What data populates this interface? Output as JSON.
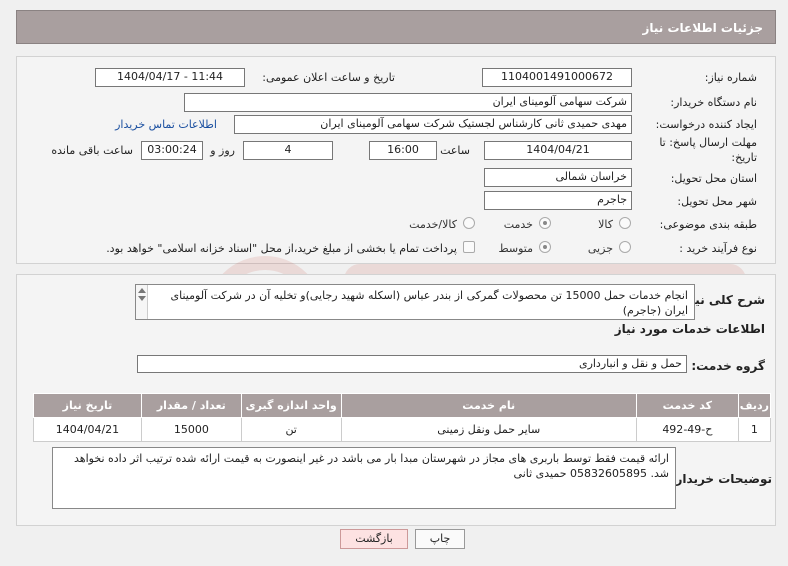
{
  "header": {
    "title": "جزئیات اطلاعات نیاز"
  },
  "form": {
    "need_number": {
      "label": "شماره نیاز:",
      "value": "1104001491000672"
    },
    "announce_datetime": {
      "label": "تاریخ و ساعت اعلان عمومی:",
      "value": "1404/04/17 - 11:44"
    },
    "buyer_org": {
      "label": "نام دستگاه خریدار:",
      "value": "شرکت سهامی آلومینای ایران"
    },
    "requester": {
      "label": "ایجاد کننده درخواست:",
      "value": "مهدی حمیدی ثانی کارشناس لجستیک شرکت سهامی آلومینای ایران",
      "contact_link": "اطلاعات تماس خریدار"
    },
    "deadline": {
      "label": "مهلت ارسال پاسخ: تا تاریخ:",
      "date": "1404/04/21",
      "time_label": "ساعت",
      "time": "16:00",
      "days": "4",
      "days_label": "روز و",
      "remaining": "03:00:24",
      "remaining_label": "ساعت باقی مانده"
    },
    "province": {
      "label": "استان محل تحویل:",
      "value": "خراسان شمالی"
    },
    "city": {
      "label": "شهر محل تحویل:",
      "value": "جاجرم"
    },
    "category": {
      "label": "طبقه بندی موضوعی:",
      "options": [
        "کالا",
        "خدمت",
        "کالا/خدمت"
      ],
      "selected": "خدمت"
    },
    "purchase_type": {
      "label": "نوع فرآیند خرید :",
      "options": [
        "جزیی",
        "متوسط"
      ],
      "selected": "متوسط",
      "payment_note": "پرداخت تمام یا بخشی از مبلغ خرید،از محل \"اسناد خزانه اسلامی\" خواهد بود."
    }
  },
  "summary": {
    "label": "شرح کلی نیاز:",
    "text": "انجام خدمات حمل 15000 تن محصولات گمرکی از بندر عباس (اسکله شهید رجایی)و تخلیه آن در شرکت آلومینای ایران (جاجرم)"
  },
  "services": {
    "section_title": "اطلاعات خدمات مورد نیاز",
    "group_label": "گروه خدمت:",
    "group_value": "حمل و نقل و انبارداری",
    "columns": [
      "ردیف",
      "کد خدمت",
      "نام خدمت",
      "واحد اندازه گیری",
      "تعداد / مقدار",
      "تاریخ نیاز"
    ],
    "rows": [
      {
        "row": "1",
        "code": "ح-49-492",
        "name": "سایر حمل ونقل زمینی",
        "unit": "تن",
        "qty": "15000",
        "date": "1404/04/21"
      }
    ]
  },
  "buyer_notes": {
    "label": "توضیحات خریدار:",
    "text": "ارائه قیمت فقط توسط باربری های مجاز در شهرستان مبدا بار می باشد در غیر اینصورت به قیمت ارائه شده ترتیب اثر داده نخواهد شد. 05832605895 حمیدی ثانی"
  },
  "buttons": {
    "print": "چاپ",
    "back": "بازگشت"
  },
  "colors": {
    "header_bg": "#a99f9f",
    "link": "#1a4fa0",
    "back_button": "#fde2e2"
  }
}
